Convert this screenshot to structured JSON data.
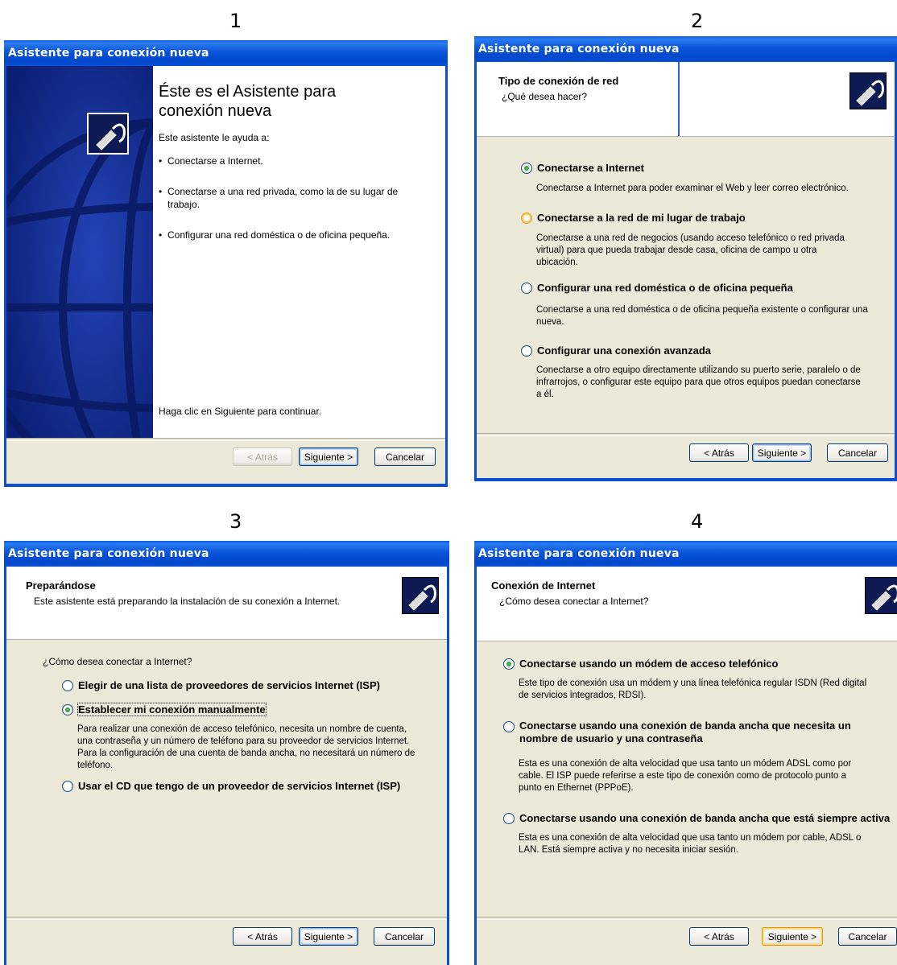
{
  "panel_numbers": [
    "1",
    "2",
    "3",
    "4"
  ],
  "window_title": "Asistente para conexión nueva",
  "buttons": {
    "back": "< Atrás",
    "next": "Siguiente >",
    "cancel": "Cancelar"
  },
  "window1": {
    "heading": "Éste es el Asistente para conexión nueva",
    "intro": "Este asistente le ayuda a:",
    "bullets": [
      "Conectarse a Internet.",
      "Conectarse a una red privada, como la de su lugar de trabajo.",
      "Configurar una red doméstica o de oficina pequeña."
    ],
    "footer_text": "Haga clic en Siguiente para continuar."
  },
  "window2": {
    "header_title": "Tipo de conexión de red",
    "header_subtitle": "¿Qué desea hacer?",
    "options": [
      {
        "label": "Conectarse a Internet",
        "description": "Conectarse a Internet para poder examinar el Web y leer correo electrónico.",
        "selected": true
      },
      {
        "label": "Conectarse a la red de mi lugar de trabajo",
        "description": "Conectarse a una red de negocios (usando acceso telefónico o red privada virtual) para que pueda trabajar desde casa, oficina de campo u otra ubicación.",
        "selected": false
      },
      {
        "label": "Configurar una red doméstica o de oficina pequeña",
        "description": "Conectarse a una red doméstica o de oficina pequeña existente o configurar una nueva.",
        "selected": false
      },
      {
        "label": "Configurar una conexión avanzada",
        "description": "Conectarse a otro equipo directamente utilizando su puerto serie, paralelo o de infrarrojos, o configurar este equipo para que otros equipos puedan conectarse a él.",
        "selected": false
      }
    ]
  },
  "window3": {
    "header_title": "Preparándose",
    "header_subtitle": "Este asistente está preparando la instalación de su conexión a Internet.",
    "question": "¿Cómo desea conectar a Internet?",
    "options": [
      {
        "label": "Elegir de una lista de proveedores de servicios Internet (ISP)",
        "selected": false
      },
      {
        "label": "Establecer mi conexión manualmente",
        "description": "Para realizar una conexión de acceso telefónico, necesita un nombre de cuenta, una contraseña y un número de teléfono para su proveedor de servicios Internet. Para la configuración de una cuenta de banda ancha, no necesitará un número de teléfono.",
        "selected": true
      },
      {
        "label": "Usar el CD que tengo de un proveedor de servicios Internet (ISP)",
        "selected": false
      }
    ]
  },
  "window4": {
    "header_title": "Conexión de Internet",
    "header_subtitle": "¿Cómo desea conectar a Internet?",
    "options": [
      {
        "label": "Conectarse usando un módem de acceso telefónico",
        "description": "Este tipo de conexión usa un módem y una línea telefónica regular ISDN (Red digital de servicios integrados, RDSI).",
        "selected": true
      },
      {
        "label": "Conectarse usando una conexión de banda ancha que necesita un nombre de usuario y una contraseña",
        "description": "Esta es una conexión de alta velocidad que usa tanto un módem ADSL como por cable. El ISP puede referirse a este tipo de conexión como de protocolo punto a punto en Ethernet (PPPoE).",
        "selected": false
      },
      {
        "label": "Conectarse usando una conexión de banda ancha que está siempre activa",
        "description": "Esta es una conexión de alta velocidad que usa tanto un módem por cable, ADSL o LAN. Está siempre activa y no necesita iniciar sesión.",
        "selected": false
      }
    ]
  }
}
